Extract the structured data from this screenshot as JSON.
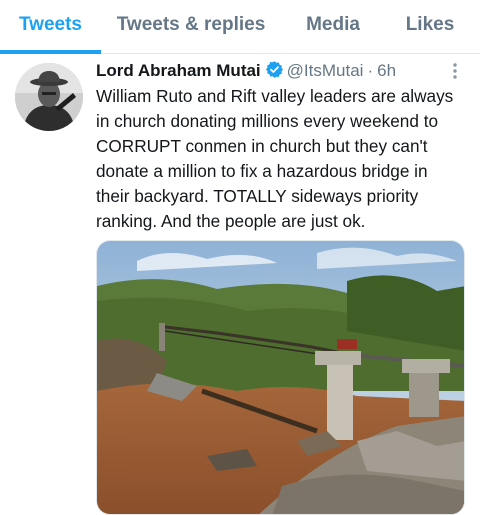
{
  "tabs": [
    {
      "label": "Tweets",
      "active": true
    },
    {
      "label": "Tweets & replies",
      "active": false
    },
    {
      "label": "Media",
      "active": false
    },
    {
      "label": "Likes",
      "active": false
    }
  ],
  "tweet": {
    "author_name": "Lord Abraham Mutai",
    "verified": true,
    "handle": "@ItsMutai",
    "separator": "·",
    "time": "6h",
    "text_lines": [
      "William Ruto and Rift valley leaders are always",
      "in church donating millions every weekend to",
      "CORRUPT conmen in church but they can't",
      "donate a million to fix a hazardous bridge in",
      "their backyard. TOTALLY sideways priority",
      "ranking. And the people are just ok."
    ],
    "icons": {
      "verified": "verified-badge-icon",
      "more": "more-options-icon"
    },
    "media": {
      "kind": "photo",
      "subject": "collapsed bridge over flooded brown river"
    }
  },
  "colors": {
    "accent": "#1da1f2",
    "secondary_text": "#657786",
    "primary_text": "#14171a",
    "divider": "#e1e8ed"
  }
}
